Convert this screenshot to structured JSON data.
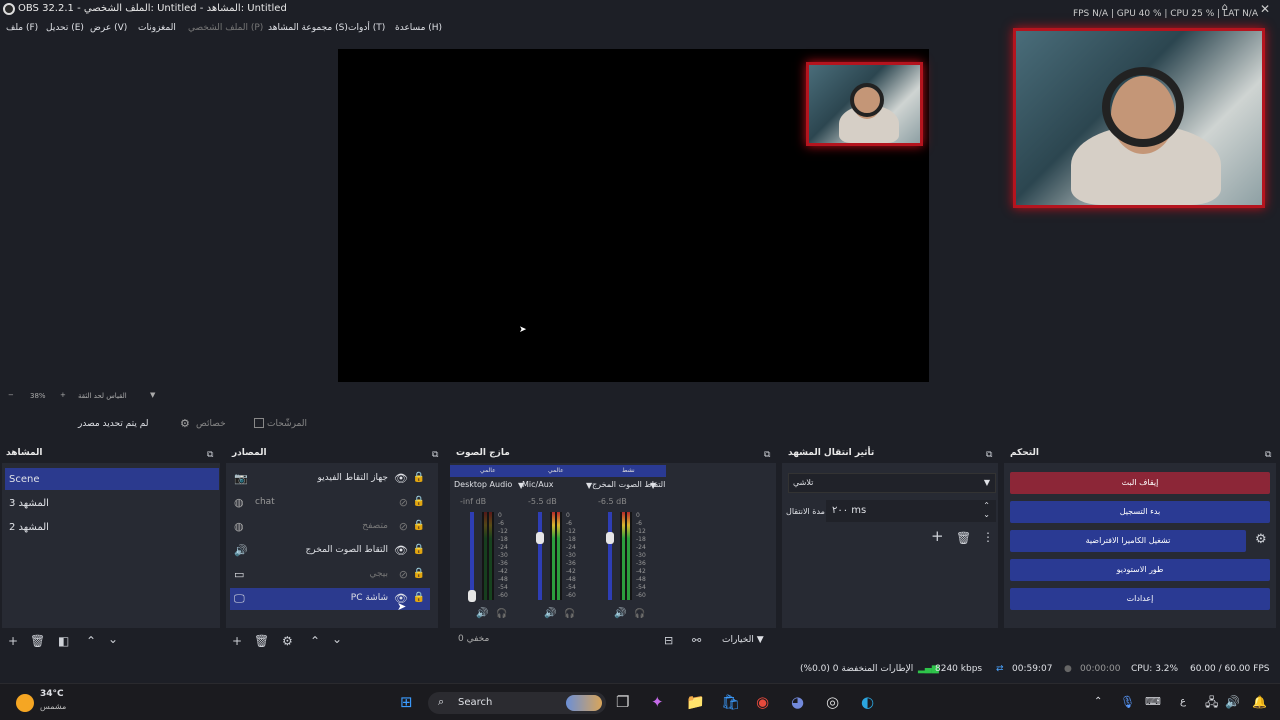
{
  "window": {
    "title": "OBS 32.2.1 - الملف الشخصي: Untitled - المشاهد: Untitled",
    "stats": "FPS  N/A   |  GPU 40 %  |  CPU 25 %  |  LAT  N/A"
  },
  "menu": [
    "ملف (F)",
    "تحديل (E)",
    "عرض (V)",
    "المغزونات",
    "الملف الشخصي (P)",
    "مجموعة المشاهد (S)",
    "أدوات (T)",
    "مساعدة (H)"
  ],
  "zoom": {
    "value": "38%",
    "mode": "القياس لحد الثقة"
  },
  "toolbar": {
    "no_source": "لم يتم تحديد مصدر",
    "properties": "خصائص",
    "filters": "المرشّحات"
  },
  "panels": {
    "scenes": "المشاهد",
    "sources": "المصادر",
    "mixer": "مازج الصوت",
    "transitions": "تأثير انتقال المشهد",
    "controls": "التحكم"
  },
  "scenes": [
    {
      "name": "Scene",
      "selected": true
    },
    {
      "name": "المشهد 3"
    },
    {
      "name": "المشهد 2"
    }
  ],
  "sources": [
    {
      "name": "جهاز التقاط الفيديو",
      "icon": "camera-icon",
      "visible": true
    },
    {
      "name": "chat",
      "icon": "browser-icon",
      "visible": false
    },
    {
      "name": "متصفح",
      "icon": "browser-icon",
      "visible": false
    },
    {
      "name": "التقاط الصوت المخرج",
      "icon": "speaker-icon",
      "visible": true
    },
    {
      "name": "بيجي",
      "icon": "window-icon",
      "visible": false
    },
    {
      "name": "PC شاشة",
      "icon": "monitor-icon",
      "visible": true,
      "selected": true
    }
  ],
  "mixer": {
    "channels": [
      {
        "name": "Desktop Audio",
        "db": "-inf dB",
        "tag": "عالمي",
        "level": 0
      },
      {
        "name": "Mic/Aux",
        "db": "-5.5 dB",
        "tag": "عالمي",
        "level": 0.62
      },
      {
        "name": "التقاط الصوت المخرج",
        "db": "-6.5 dB",
        "tag": "نشط",
        "level": 0.58
      }
    ],
    "scale": [
      "0",
      "-6",
      "-12",
      "-18",
      "-24",
      "-30",
      "-36",
      "-42",
      "-48",
      "-54",
      "-60"
    ],
    "muted": "0 مخفي"
  },
  "transitions": {
    "selected": "تلاشي",
    "duration_label": "مدة الانتقال",
    "duration": "٢٠٠ ms",
    "options": "الخيارات"
  },
  "controls": {
    "stop_stream": "إيقاف البث",
    "start_record": "بدء التسجيل",
    "virtual_cam": "تشغيل الكاميرا الافتراضية",
    "studio": "طور الاستوديو",
    "settings": "إعدادات"
  },
  "status": {
    "dropped": "الإطارات المنخفضة 0 (0.0%)",
    "bitrate": "8240 kbps",
    "stream_time": "00:59:07",
    "rec_time": "00:00:00",
    "cpu": "CPU: 3.2%",
    "fps": "60.00 / 60.00 FPS"
  },
  "taskbar": {
    "temp": "34°C",
    "weather": "مشمس",
    "search": "Search",
    "lang": "ع"
  },
  "colors": {
    "stop_stream": "#8c2637",
    "accent": "#2a3a93",
    "cam_border": "#b5141e"
  }
}
